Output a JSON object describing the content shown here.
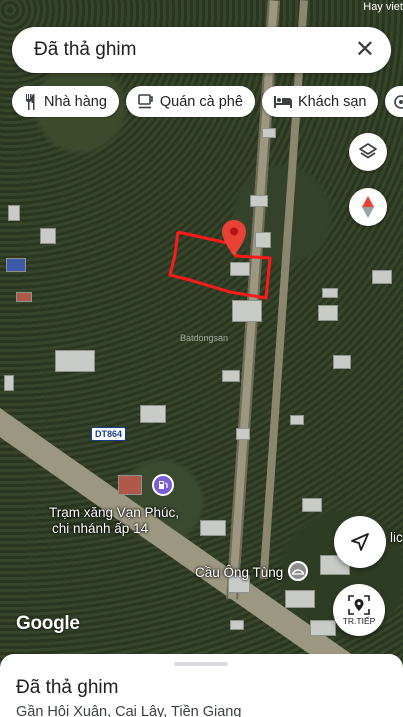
{
  "status": {
    "time": "",
    "right": "Hay viet"
  },
  "search": {
    "query": "Đã thả ghim",
    "close_icon": "close-icon"
  },
  "chips": [
    {
      "label": "Nhà hàng",
      "icon": "restaurant-icon"
    },
    {
      "label": "Quán cà phê",
      "icon": "coffee-icon"
    },
    {
      "label": "Khách sạn",
      "icon": "hotel-icon"
    }
  ],
  "map": {
    "road_shield": "DT864",
    "poi_gas": "Trạm xăng Vạn Phúc,",
    "poi_gas_line2": "chi nhánh ấp 14",
    "bridge": "Cầu Ông Tùng",
    "watermark": "Batdongsan",
    "attribution": "Google",
    "partial_label": "lic"
  },
  "controls": {
    "layers_icon": "layers-icon",
    "compass_icon": "compass-icon",
    "directions_icon": "navigation-arrow-icon",
    "start_label": "TR.TIẾP"
  },
  "sheet": {
    "title": "Đã thả ghim",
    "subtitle": "Gần Hội Xuân, Cai Lậy, Tiền Giang"
  },
  "colors": {
    "pin": "#e94235",
    "boundary": "#ff1a1a",
    "accent": "#1a73e8"
  }
}
